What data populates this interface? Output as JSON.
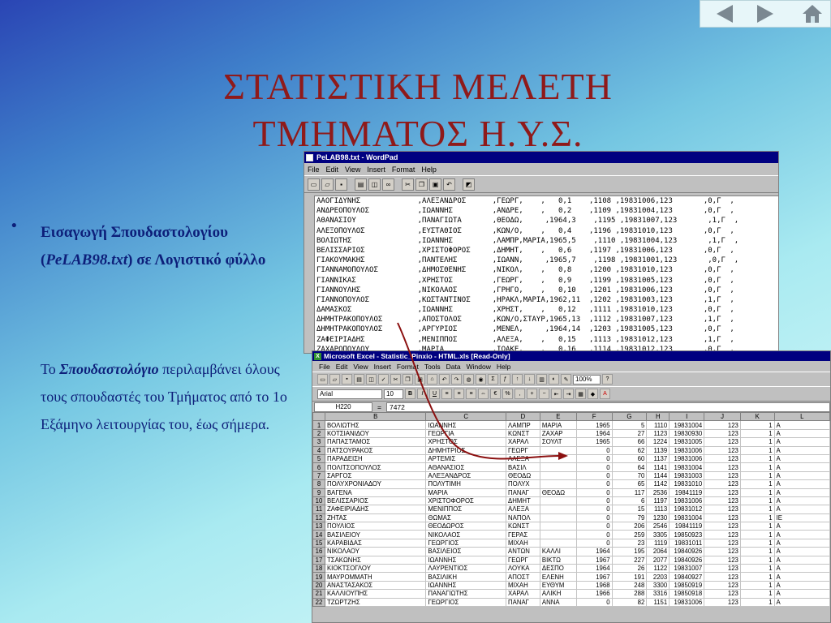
{
  "slide": {
    "title_line1": "ΣΤΑΤΙΣΤΙΚΗ ΜΕΛΕΤΗ",
    "title_line2": "ΤΜΗΜΑΤΟΣ  Η.Υ.Σ.",
    "bullet_symbol": "•",
    "bullet_part1": "Εισαγωγή Σπουδαστολογίου (",
    "bullet_file": "PeLAB98.txt",
    "bullet_part2": ") σε Λογιστικό φύλλο",
    "para_prefix": "Το ",
    "para_bold": "Σπουδαστολόγιο",
    "para_rest": " περιλαμβάνει όλους τους σπουδαστές του Τμήματος από το 1ο Εξάμηνο λειτουργίας του, έως σήμερα.",
    "nav": {
      "prev_icon": "triangle-left-icon",
      "next_icon": "triangle-right-icon",
      "home_icon": "home-icon"
    },
    "colors": {
      "title": "#8f1a1a",
      "text": "#0d1f7a",
      "arrow": "#8b1010"
    }
  },
  "wordpad": {
    "title": "PeLAB98.txt - WordPad",
    "menu": [
      "File",
      "Edit",
      "View",
      "Insert",
      "Format",
      "Help"
    ],
    "lines": [
      "ΑΑΟΓΙΔΥΝΗΣ             ,ΑΛΕΞΑΝΔΡΟΣ      ,ΓΕΩΡΓ,    ,   0,1    ,1108 ,19831006,123       ,0,Γ  ,",
      "ΑΝΔΡΕΟΠΟΥΛΟΣ           ,ΙΩΑΝΝΗΣ         ,ΑΝΔΡΕ,    ,   0,2    ,1109 ,19831004,123       ,0,Γ  ,",
      "ΑΘΑΝΑΣΙΟΥ              ,ΠΑΝΑΓΙΩΤΑ       ,ΘΕΟΔΩ,     ,1964,3    ,1195 ,19831007,123       ,1,Γ  ,",
      "ΑΛΕΞΟΠΟΥΛΟΣ            ,ΕΥΣΤΑΘΙΟΣ       ,ΚΩΝ/Ο,    ,   0,4    ,1196 ,19831010,123       ,0,Γ  ,",
      "ΒΟΛΙΩΤΗΣ               ,ΙΩΑΝΝΗΣ         ,ΛΑΜΠΡ,ΜΑΡΙΑ,1965,5    ,1110 ,19831004,123       ,1,Γ  ,",
      "ΒΕΛΙΣΣΑΡΙΟΣ            ,ΧΡΙΣΤΟΦΟΡΟΣ     ,ΔΗΜΗΤ,    ,   0,6    ,1197 ,19831006,123       ,0,Γ  ,",
      "ΓΙΑΚΟΥΜΑΚΗΣ            ,ΠΑΝΤΕΛΗΣ        ,ΙΩΑΝΝ,     ,1965,7    ,1198 ,19831001,123       ,0,Γ  ,",
      "ΓΙΑΝΝΑΜΟΠΟΥΛΟΣ         ,ΔΗΜΟΣΘΕΝΗΣ      ,ΝΙΚΟΛ,    ,   0,8    ,1200 ,19831010,123       ,0,Γ  ,",
      "ΓΙΑΝΝΙΚΑΣ              ,ΧΡΗΣΤΟΣ         ,ΓΕΩΡΓ,    ,   0,9    ,1199 ,19831005,123       ,0,Γ  ,",
      "ΓΙΑΝΝΟΥΛΗΣ             ,ΝΙΚΟΛΑΟΣ        ,ΓΡΗΓΟ,    ,   0,10   ,1201 ,19831006,123       ,0,Γ  ,",
      "ΓΙΑΝΝΟΠΟΥΛΟΣ           ,ΚΩΣΤΑΝΤΙΝΟΣ     ,ΗΡΑΚΛ,ΜΑΡΙΑ,1962,11  ,1202 ,19831003,123       ,1,Γ  ,",
      "ΔΑΜΑΣΚΟΣ               ,ΙΩΑΝΝΗΣ         ,ΧΡΗΣΤ,    ,   0,12   ,1111 ,19831010,123       ,0,Γ  ,",
      "ΔΗΜΗΤΡΑΚΟΠΟΥΛΟΣ        ,ΑΠΟΣΤΟΛΟΣ       ,ΚΩΝ/Ο,ΣΤΑΥΡ,1965,13  ,1112 ,19831007,123       ,1,Γ  ,",
      "ΔΗΜΗΤΡΑΚΟΠΟΥΛΟΣ        ,ΑΡΓΥΡΙΟΣ        ,ΜΕΝΕΛ,     ,1964,14  ,1203 ,19831005,123       ,0,Γ  ,",
      "ΖΑΦΕΙΡΙΑΔΗΣ            ,ΜΕΝΙΠΠΟΣ        ,ΑΛΕΞΑ,    ,   0,15   ,1113 ,19831012,123       ,1,Γ  ,",
      "ΖΑΧΑΡΟΠΟΥΛΟΥ           ,ΜΑΡΙΑ           ,ΙΩΑΚΕ,    ,   0,16   ,1114 ,19831012,123       ,0,Γ  ,"
    ]
  },
  "excel": {
    "title": "Microsoft Excel - Statistic_Pinxio - HTML.xls  [Read-Only]",
    "menu": [
      "File",
      "Edit",
      "View",
      "Insert",
      "Format",
      "Tools",
      "Data",
      "Window",
      "Help"
    ],
    "font": "Arial",
    "font_size": "10",
    "zoom": "100%",
    "name_box": "H220",
    "formula_value": "7472",
    "columns": [
      "B",
      "C",
      "D",
      "E",
      "F",
      "G",
      "H",
      "I",
      "J",
      "K",
      "L"
    ],
    "rows": [
      [
        "1",
        "ΒΟΛΙΩΤΗΣ",
        "ΙΩΑΝΝΗΣ",
        "ΛΑΜΠΡ",
        "ΜΑΡΙΑ",
        "1965",
        "5",
        "1110",
        "19831004",
        "123",
        "1",
        "Α"
      ],
      [
        "2",
        "ΚΟΤΣΙΑΝΙΔΟΥ",
        "ΓΕΩΡΓΙΑ",
        "ΚΩΝΣΤ",
        "ΖΑΧΑΡ",
        "1964",
        "27",
        "1123",
        "19830930",
        "123",
        "1",
        "Α"
      ],
      [
        "3",
        "ΠΑΠΑΣΤΑΜΟΣ",
        "ΧΡΗΣΤΟΣ",
        "ΧΑΡΑΛ",
        "ΣΟΥΛΤ",
        "1965",
        "66",
        "1224",
        "19831005",
        "123",
        "1",
        "Α"
      ],
      [
        "4",
        "ΠΑΤΣΟΥΡΑΚΟΣ",
        "ΔΗΜΗΤΡΙΟΣ",
        "ΓΕΩΡΓ",
        "",
        "0",
        "62",
        "1139",
        "19831006",
        "123",
        "1",
        "Α"
      ],
      [
        "5",
        "ΠΑΡΑΔΕΙΣΗ",
        "ΑΡΤΕΜΙΣ",
        "ΑΛΕΞΑ",
        "",
        "0",
        "60",
        "1137",
        "19831006",
        "123",
        "1",
        "Α"
      ],
      [
        "6",
        "ΠΟΛΙΤΣΟΠΟΥΛΟΣ",
        "ΑΘΑΝΑΣΙΟΣ",
        "ΒΑΣΙΛ",
        "",
        "0",
        "64",
        "1141",
        "19831004",
        "123",
        "1",
        "Α"
      ],
      [
        "7",
        "ΣΑΡΓΟΣ",
        "ΑΛΕΞΑΝΔΡΟΣ",
        "ΘΕΟΔΩ",
        "",
        "0",
        "70",
        "1144",
        "19831003",
        "123",
        "1",
        "Α"
      ],
      [
        "8",
        "ΠΟΛΥΧΡΟΝΙΑΔΟΥ",
        "ΠΟΛΥΤΙΜΗ",
        "ΠΟΛΥΧ",
        "",
        "0",
        "65",
        "1142",
        "19831010",
        "123",
        "1",
        "Α"
      ],
      [
        "9",
        "ΒΑΓΕΝΑ",
        "ΜΑΡΙΑ",
        "ΠΑΝΑΓ",
        "ΘΕΟΔΩ",
        "0",
        "117",
        "2536",
        "19841119",
        "123",
        "1",
        "Α"
      ],
      [
        "10",
        "ΒΕΛΙΣΣΑΡΙΟΣ",
        "ΧΡΙΣΤΟΦΟΡΟΣ",
        "ΔΗΜΗΤ",
        "",
        "0",
        "6",
        "1197",
        "19831006",
        "123",
        "1",
        "Α"
      ],
      [
        "11",
        "ΖΑΦΕΙΡΙΑΔΗΣ",
        "ΜΕΝΙΠΠΟΣ",
        "ΑΛΕΞΑ",
        "",
        "0",
        "15",
        "1113",
        "19831012",
        "123",
        "1",
        "Α"
      ],
      [
        "12",
        "ΖΗΤΑΣ",
        "ΘΩΜΑΣ",
        "ΝΑΠΟΛ",
        "",
        "0",
        "79",
        "1230",
        "19831004",
        "123",
        "1",
        "ΙΕ"
      ],
      [
        "13",
        "ΠΟΥΛΙΟΣ",
        "ΘΕΟΔΩΡΟΣ",
        "ΚΩΝΣΤ",
        "",
        "0",
        "206",
        "2546",
        "19841119",
        "123",
        "1",
        "Α"
      ],
      [
        "14",
        "ΒΑΣΙΛΕΙΟΥ",
        "ΝΙΚΟΛΑΟΣ",
        "ΓΕΡΑΣ",
        "",
        "0",
        "259",
        "3305",
        "19850923",
        "123",
        "1",
        "Α"
      ],
      [
        "15",
        "ΚΑΡΑΒΙΔΑΣ",
        "ΓΕΩΡΓΙΟΣ",
        "ΜΙΧΑΗ",
        "",
        "0",
        "23",
        "1119",
        "19831011",
        "123",
        "1",
        "Α"
      ],
      [
        "16",
        "ΝΙΚΟΛΑΟΥ",
        "ΒΑΣΙΛΕΙΟΣ",
        "ΑΝΤΩΝ",
        "ΚΑΛΛΙ",
        "1964",
        "195",
        "2064",
        "19840926",
        "123",
        "1",
        "Α"
      ],
      [
        "17",
        "ΤΣΑΚΩΝΗΣ",
        "ΙΩΑΝΝΗΣ",
        "ΓΕΩΡΓ",
        "ΒΙΚΤΩ",
        "1967",
        "227",
        "2077",
        "19840926",
        "123",
        "1",
        "Α"
      ],
      [
        "18",
        "ΚΙΟΚΤΣΟΓΛΟΥ",
        "ΛΑΥΡΕΝΤΙΟΣ",
        "ΛΟΥΚΑ",
        "ΔΕΣΠΟ",
        "1964",
        "26",
        "1122",
        "19831007",
        "123",
        "1",
        "Α"
      ],
      [
        "19",
        "ΜΑΥΡΟΜΜΑΤΗ",
        "ΒΑΣΙΛΙΚΗ",
        "ΑΠΟΣΤ",
        "ΕΛΕΝΗ",
        "1967",
        "191",
        "2203",
        "19840927",
        "123",
        "1",
        "Α"
      ],
      [
        "20",
        "ΑΝΑΣΤΑΣΑΚΟΣ",
        "ΙΩΑΝΝΗΣ",
        "ΜΙΧΑΗ",
        "ΕΥΘΥΜ",
        "1968",
        "248",
        "3300",
        "19850919",
        "123",
        "1",
        "Α"
      ],
      [
        "21",
        "ΚΑΛΛΙΟΥΠΗΣ",
        "ΠΑΝΑΓΙΩΤΗΣ",
        "ΧΑΡΑΛ",
        "ΑΛΙΚΗ",
        "1966",
        "288",
        "3316",
        "19850918",
        "123",
        "1",
        "Α"
      ],
      [
        "22",
        "ΤΖΩΡΤΖΗΣ",
        "ΓΕΩΡΓΙΟΣ",
        "ΠΑΝΑΓ",
        "ΑΝΝΑ",
        "0",
        "82",
        "1151",
        "19831006",
        "123",
        "1",
        "Α"
      ]
    ]
  }
}
